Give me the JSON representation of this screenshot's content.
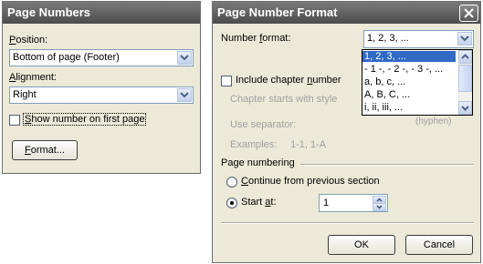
{
  "page_numbers": {
    "title": "Page Numbers",
    "position_label": "Position:",
    "position_value": "Bottom of page (Footer)",
    "alignment_label": "Alignment:",
    "alignment_value": "Right",
    "show_first_page_label": "Show number on first page",
    "show_first_page_checked": false,
    "format_button": "Format..."
  },
  "page_number_format": {
    "title": "Page Number Format",
    "number_format_label": "Number format:",
    "number_format_value": "1, 2, 3, ...",
    "number_format_options": [
      "1, 2, 3, ...",
      "- 1 -, - 2 -, - 3 -, ...",
      "a, b, c, ...",
      "A, B, C, ...",
      "i, ii, iii, ..."
    ],
    "selected_option_index": 0,
    "include_chapter_label": "Include chapter number",
    "chapter_starts_label": "Chapter starts with style",
    "use_separator_label": "Use separator:",
    "separator_value_partial": "(hyphen)",
    "examples_label": "Examples:",
    "examples_value": "1-1, 1-A",
    "page_numbering_label": "Page numbering",
    "continue_label": "Continue from previous section",
    "start_at_label": "Start at:",
    "start_at_value": "1",
    "ok_button": "OK",
    "cancel_button": "Cancel"
  }
}
